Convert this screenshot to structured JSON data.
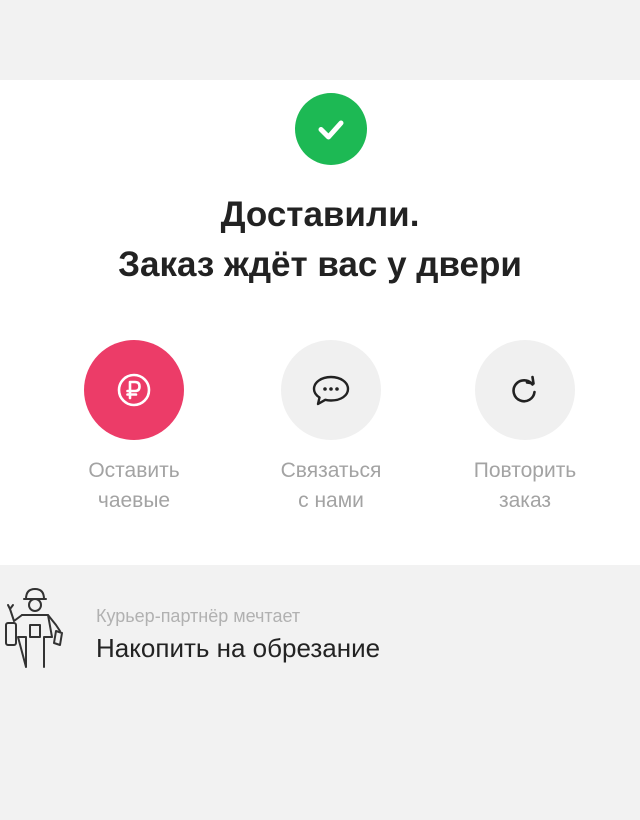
{
  "status": {
    "icon": "check-icon",
    "title_line1": "Доставили.",
    "title_line2": "Заказ ждёт вас у двери",
    "accent_color": "#1db954"
  },
  "actions": [
    {
      "id": "tip",
      "icon": "ruble-icon",
      "label": "Оставить\nчаевые",
      "color": "#ec3c68"
    },
    {
      "id": "contact",
      "icon": "chat-bubble-icon",
      "label": "Связаться\nс нами",
      "color": "#f0f0f0"
    },
    {
      "id": "repeat",
      "icon": "refresh-icon",
      "label": "Повторить\nзаказ",
      "color": "#f0f0f0"
    }
  ],
  "courier": {
    "icon": "courier-figure-icon",
    "subtitle": "Курьер-партнёр мечтает",
    "dream": "Накопить на обрезание"
  }
}
